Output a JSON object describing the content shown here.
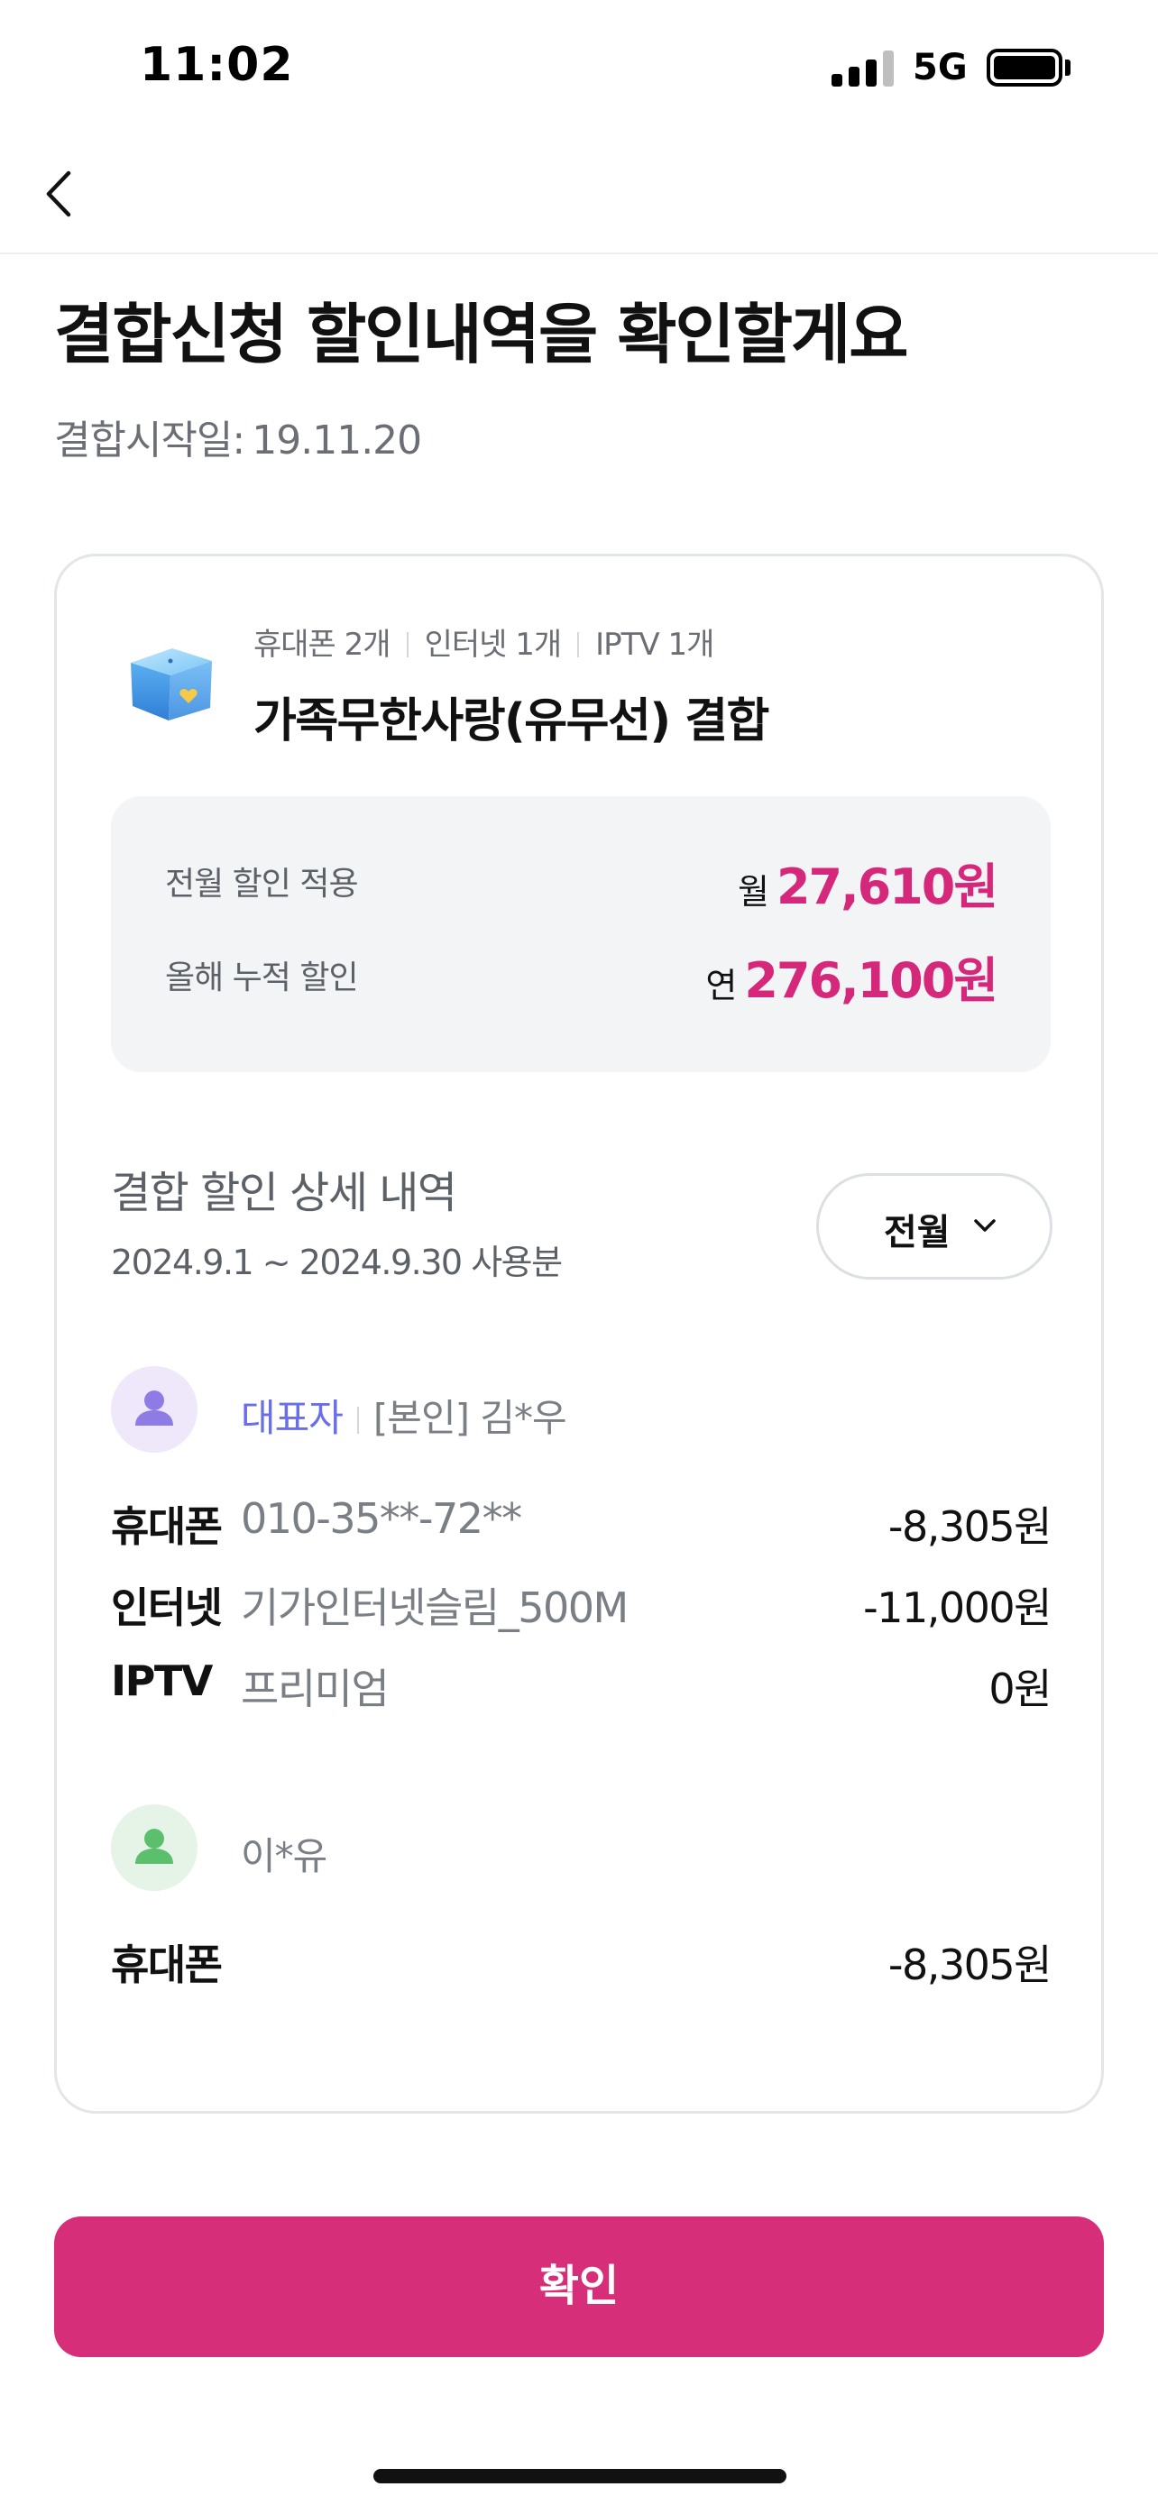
{
  "status_bar": {
    "time": "11:02",
    "network": "5G",
    "battery_level": 1.0
  },
  "nav": {
    "back_icon": "chevron-left-icon"
  },
  "header": {
    "title": "결합신청 할인내역을 확인할게요",
    "start_date_label": "결합시작일:",
    "start_date_value": "19.11.20"
  },
  "bundle": {
    "icon": "gift-box-icon",
    "tags": [
      "휴대폰 2개",
      "인터넷 1개",
      "IPTV 1개"
    ],
    "name": "가족무한사랑(유무선) 결합",
    "summary": [
      {
        "label": "전월 할인 적용",
        "unit": "월",
        "amount": "27,610원"
      },
      {
        "label": "올해 누적 할인",
        "unit": "연",
        "amount": "276,100원"
      }
    ]
  },
  "detail": {
    "title": "결합 할인 상세 내역",
    "period": "2024.9.1 ~ 2024.9.30 사용분",
    "month_select": "전월",
    "members": [
      {
        "role": "대표자",
        "relation": "[본인]",
        "name": "김*우",
        "avatar_color": "#8f7be6",
        "lines": [
          {
            "service": "휴대폰",
            "desc": "010-35**-72**",
            "discount": "-8,305원"
          },
          {
            "service": "인터넷",
            "desc": "기가인터넷슬림_500M",
            "discount": "-11,000원"
          },
          {
            "service": "IPTV",
            "desc": "프리미엄",
            "discount": "0원"
          }
        ]
      },
      {
        "name": "이*유",
        "avatar_color": "#5bbf6e",
        "lines": [
          {
            "service": "휴대폰",
            "desc": "",
            "discount": "-8,305원"
          }
        ]
      }
    ]
  },
  "actions": {
    "confirm_label": "확인"
  },
  "colors": {
    "accent": "#d62e79",
    "role_blue": "#6a6ee8"
  }
}
